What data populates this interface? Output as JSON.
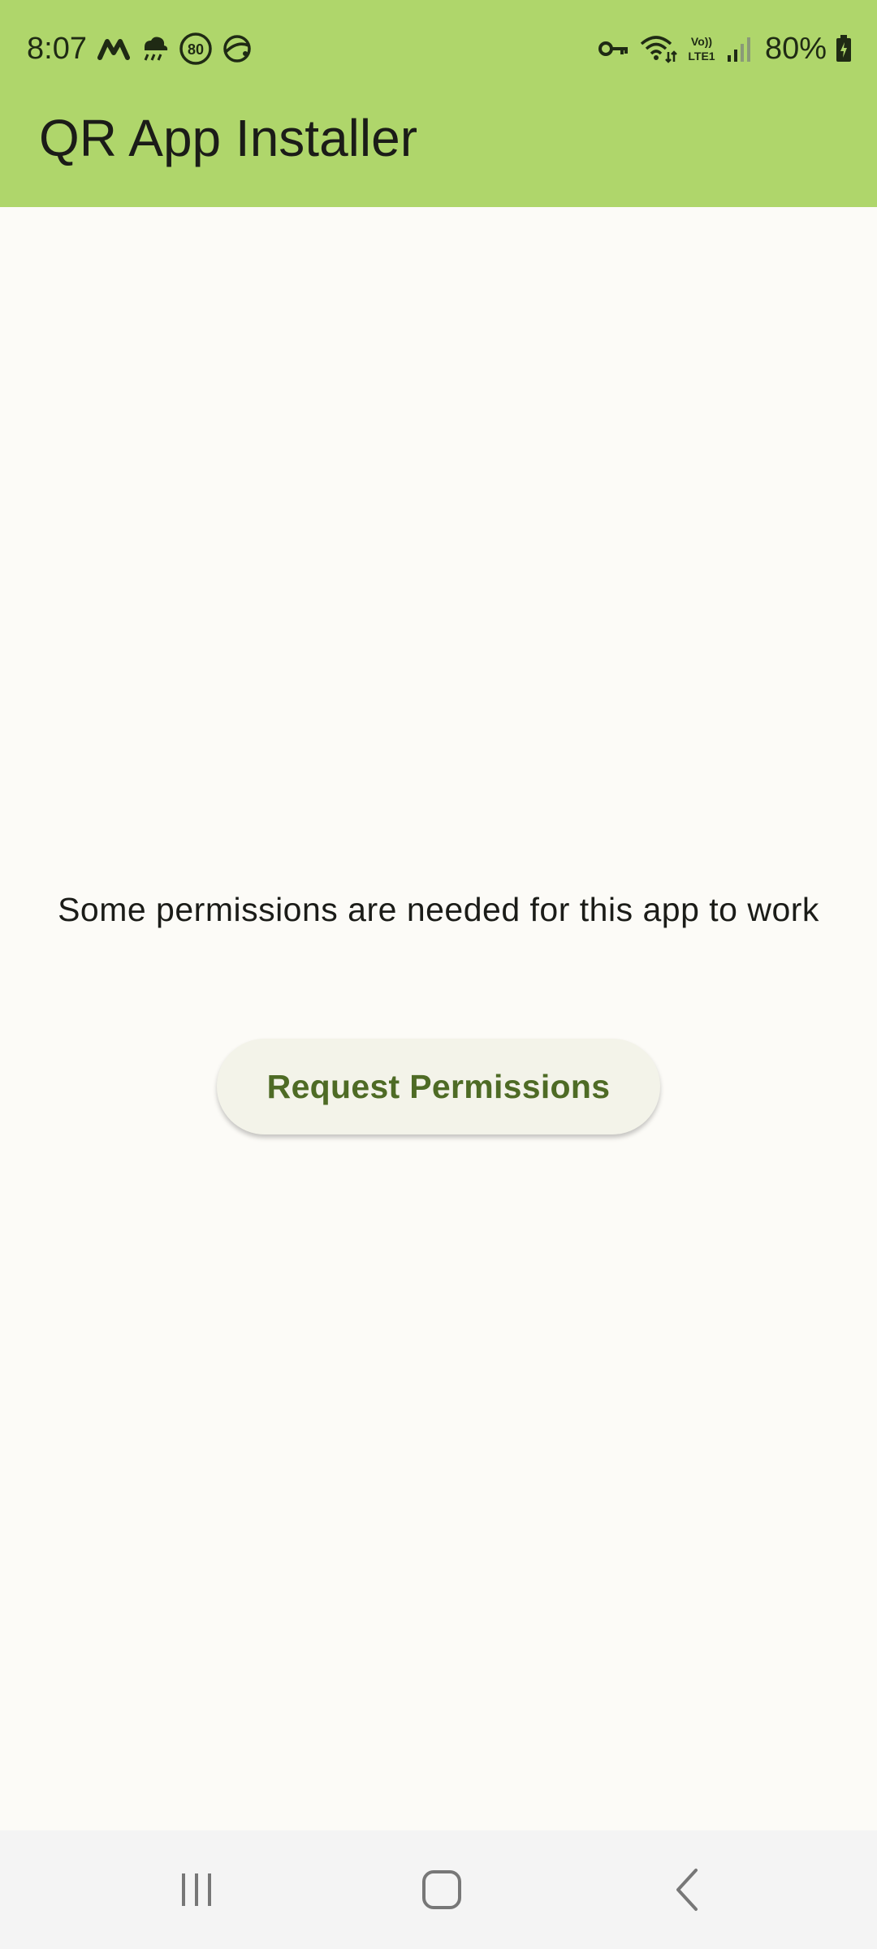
{
  "status_bar": {
    "time": "8:07",
    "left_icons": [
      "m-logo-icon",
      "weather-rain-icon",
      "speed-80-icon",
      "web-browser-icon"
    ],
    "speed_badge": "80",
    "right_icons": [
      "vpn-key-icon",
      "wifi-icon",
      "volte-icon",
      "signal-icon",
      "battery-charging-icon"
    ],
    "volte_top": "Vo))",
    "volte_bottom": "LTE1",
    "battery": "80%"
  },
  "app_bar": {
    "title": "QR App Installer",
    "color": "#afd66b"
  },
  "main": {
    "message": "Some permissions are needed for this app to work",
    "request_button_label": "Request Permissions",
    "accent_color": "#4e6b25"
  },
  "nav_bar": {
    "buttons": [
      "recent-apps-icon",
      "home-icon",
      "back-icon"
    ]
  }
}
